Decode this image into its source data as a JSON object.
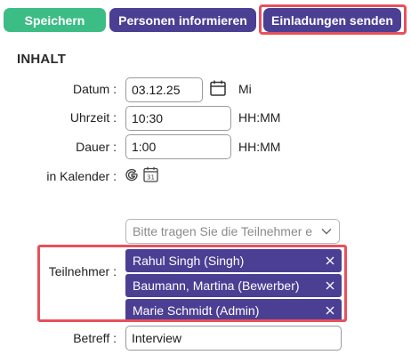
{
  "toolbar": {
    "save_label": "Speichern",
    "inform_label": "Personen informieren",
    "invite_label": "Einladungen senden"
  },
  "section": {
    "title": "INHALT"
  },
  "form": {
    "date": {
      "label": "Datum :",
      "value": "03.12.25",
      "weekday": "Mi"
    },
    "time": {
      "label": "Uhrzeit :",
      "value": "10:30",
      "format": "HH:MM"
    },
    "duration": {
      "label": "Dauer :",
      "value": "1:00",
      "format": "HH:MM"
    },
    "calendar": {
      "label": "in Kalender :"
    },
    "participants": {
      "label": "Teilnehmer :",
      "placeholder": "Bitte tragen Sie die Teilnehmer e",
      "chips": [
        "Rahul Singh (Singh)",
        "Baumann, Martina (Bewerber)",
        "Marie Schmidt (Admin)"
      ]
    },
    "subject": {
      "label": "Betreff :",
      "value": "Interview"
    }
  },
  "colors": {
    "primary": "#4b3f94",
    "success": "#3dbd86",
    "highlight": "#e8505b"
  }
}
